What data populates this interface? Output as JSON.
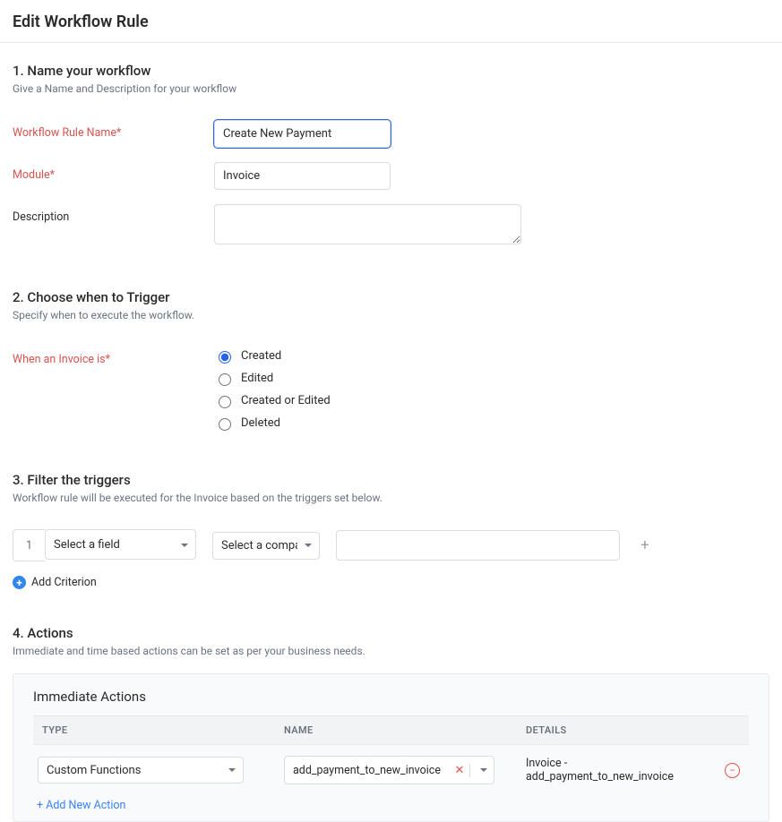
{
  "title": "Edit Workflow Rule",
  "section1": {
    "heading": "1. Name your workflow",
    "sub": "Give a Name and Description for your workflow",
    "name_label": "Workflow Rule Name*",
    "name_value": "Create New Payment",
    "module_label": "Module*",
    "module_value": "Invoice",
    "desc_label": "Description",
    "desc_value": ""
  },
  "section2": {
    "heading": "2. Choose when to Trigger",
    "sub": "Specify when to execute the workflow.",
    "when_label": "When an Invoice is*",
    "options": [
      "Created",
      "Edited",
      "Created or Edited",
      "Deleted"
    ],
    "selected": "Created"
  },
  "section3": {
    "heading": "3. Filter the triggers",
    "sub": "Workflow rule will be executed for the Invoice based on the triggers set below.",
    "row_number": "1",
    "field_placeholder": "Select a field",
    "compar_placeholder": "Select a compar...",
    "add_criterion_label": "Add Criterion"
  },
  "section4": {
    "heading": "4. Actions",
    "sub": "Immediate and time based actions can be set as per your business needs.",
    "panel_title": "Immediate Actions",
    "columns": {
      "type": "TYPE",
      "name": "NAME",
      "details": "DETAILS"
    },
    "row": {
      "type_value": "Custom Functions",
      "name_value": "add_payment_to_new_invoice",
      "details_value": "Invoice - add_payment_to_new_invoice"
    },
    "add_new_label": "+ Add New Action"
  }
}
